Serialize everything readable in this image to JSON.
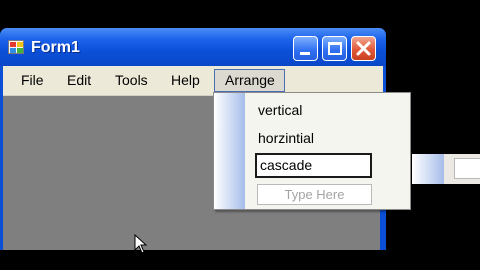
{
  "window": {
    "title": "Form1",
    "controls": [
      "minimize-icon",
      "maximize-icon",
      "close-icon"
    ]
  },
  "menubar": {
    "items": [
      {
        "label": "File"
      },
      {
        "label": "Edit"
      },
      {
        "label": "Tools"
      },
      {
        "label": "Help"
      },
      {
        "label": "Arrange"
      }
    ]
  },
  "arrange_menu": {
    "items": [
      {
        "label": "vertical"
      },
      {
        "label": "horzintial"
      }
    ],
    "edit_value": "cascade",
    "new_item_placeholder": "Type Here"
  },
  "colors": {
    "titlebar": "#0b50d8",
    "menubar": "#ece9d8",
    "client_area": "#7f7f7f",
    "close_button": "#e15a3a",
    "menu_strip": "#a6bde8"
  }
}
